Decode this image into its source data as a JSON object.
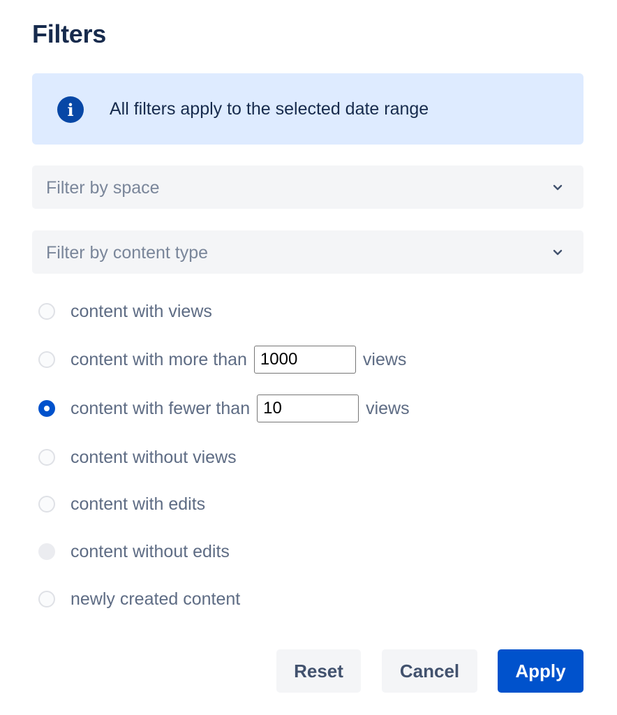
{
  "title": "Filters",
  "info": {
    "icon": "info-icon",
    "text": "All filters apply to the selected date range"
  },
  "selects": {
    "space_placeholder": "Filter by space",
    "content_type_placeholder": "Filter by content type"
  },
  "options": {
    "with_views": "content with views",
    "more_than_prefix": "content with more than",
    "more_than_value": "1000",
    "more_than_suffix": "views",
    "fewer_than_prefix": "content with fewer than",
    "fewer_than_value": "10",
    "fewer_than_suffix": "views",
    "without_views": "content without views",
    "with_edits": "content with edits",
    "without_edits": "content without edits",
    "newly_created": "newly created content"
  },
  "buttons": {
    "reset": "Reset",
    "cancel": "Cancel",
    "apply": "Apply"
  },
  "colors": {
    "primary": "#0052cc",
    "info_background": "#deebff",
    "info_icon": "#0747a6",
    "title": "#172b4d",
    "muted_text": "#5e6c84"
  }
}
